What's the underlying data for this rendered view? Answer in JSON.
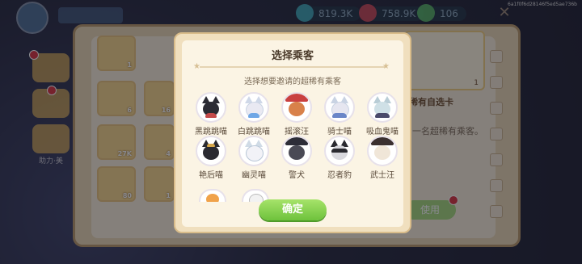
{
  "build_id": "6a1f0f6d28146f5ed5ae736b",
  "topbar": {
    "resources": [
      {
        "icon": "coin-icon",
        "value": "819.3K",
        "color": "#3fb8c9"
      },
      {
        "icon": "heart-icon",
        "value": "758.9K",
        "color": "#e04a5a"
      },
      {
        "icon": "gem-icon",
        "value": "106",
        "color": "#5ac46a"
      }
    ]
  },
  "background_panel": {
    "left_tab_label": "助力·美",
    "items": [
      {
        "icon": "book-icon",
        "count": "1"
      },
      {
        "icon": "star-card-icon",
        "count": "6"
      },
      {
        "icon": "star-card-icon",
        "count": "16"
      },
      {
        "icon": "paw-icon",
        "count": "27K"
      },
      {
        "icon": "shoe-icon",
        "count": "4"
      },
      {
        "icon": "lips-icon",
        "count": "80"
      },
      {
        "icon": "hat-icon",
        "count": "1"
      }
    ],
    "card_count": "1",
    "card_title": "稀有自选卡",
    "card_desc": "一名超稀有乘客。",
    "use_label": "使用"
  },
  "modal": {
    "title": "选择乘客",
    "subtitle": "选择想要邀请的超稀有乘客",
    "confirm_label": "确定",
    "passengers": [
      {
        "name": "黑跳跳喵",
        "color": "#2b2b33",
        "accent": "#c44a4a"
      },
      {
        "name": "白跳跳喵",
        "color": "#e9e9f2",
        "accent": "#6fa7e6"
      },
      {
        "name": "摇滚汪",
        "color": "#d8814a",
        "accent": "#c94040"
      },
      {
        "name": "骑士喵",
        "color": "#e6e6f0",
        "accent": "#6a86c8"
      },
      {
        "name": "吸血鬼喵",
        "color": "#cfe0e6",
        "accent": "#4a4a6a"
      },
      {
        "name": "艳后喵",
        "color": "#2a2a30",
        "accent": "#d7a84a"
      },
      {
        "name": "幽灵喵",
        "color": "#f2f2f7",
        "accent": "#b7c6d6"
      },
      {
        "name": "警犬",
        "color": "#4a4a55",
        "accent": "#2d2d38"
      },
      {
        "name": "忍者豹",
        "color": "#d9d9de",
        "accent": "#2a2a30"
      },
      {
        "name": "武士汪",
        "color": "#f0e6d8",
        "accent": "#3a3030"
      }
    ]
  }
}
